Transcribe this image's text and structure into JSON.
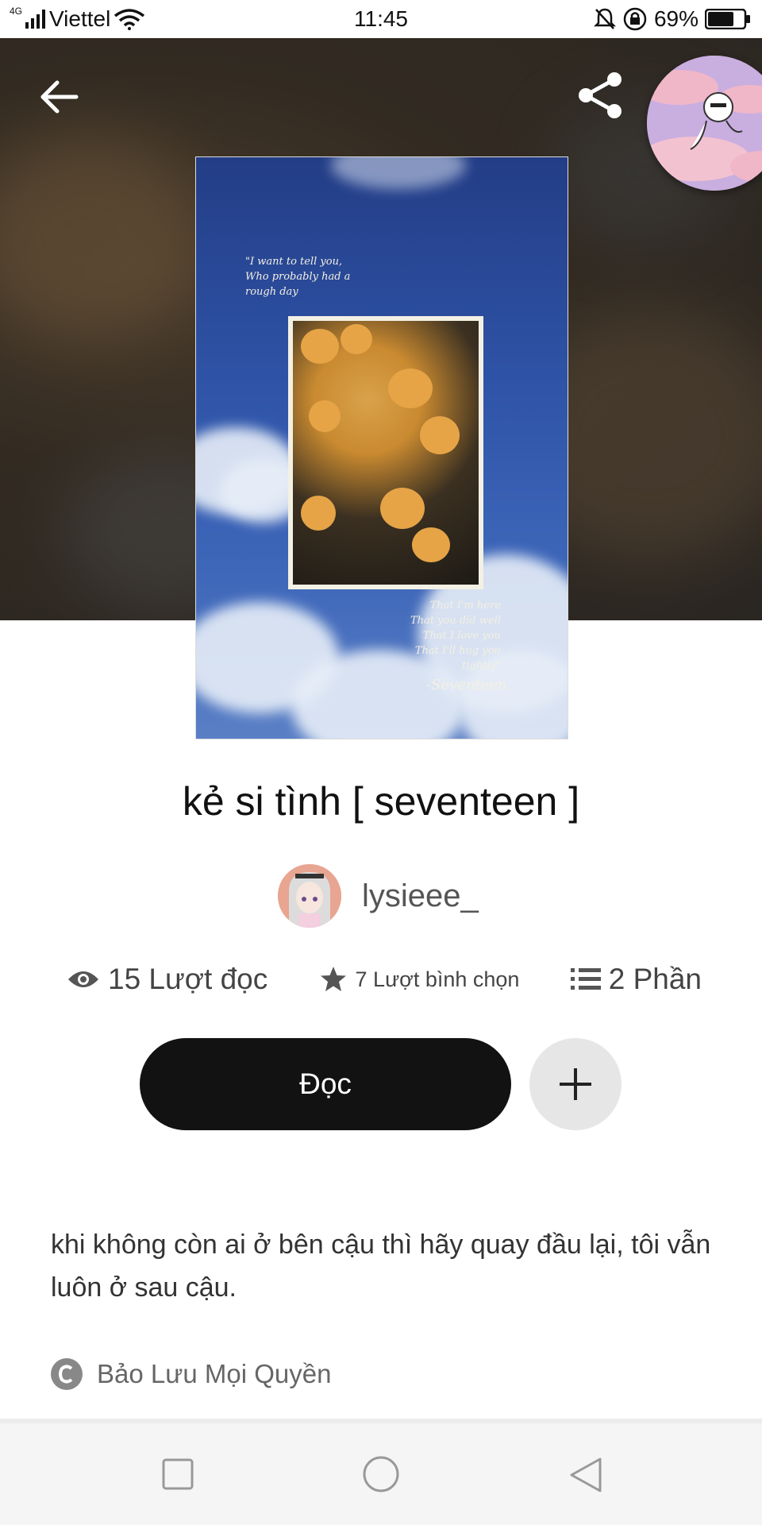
{
  "status_bar": {
    "network": "4G",
    "carrier": "Viettel",
    "time": "11:45",
    "battery": "69%"
  },
  "header": {
    "back_icon": "arrow-left-icon",
    "share_icon": "share-icon"
  },
  "cover": {
    "quote_top": "\"I want to tell you,\nWho probably had a\nrough day",
    "quote_bottom": "That I'm here\nThat you did well\nThat I love you\nThat I'll hug you\ntightly\"",
    "signature": "-Seventeen"
  },
  "story": {
    "title": "kẻ si tình [ seventeen ]",
    "author": "lysieee_",
    "reads": "15 Lượt đọc",
    "votes": "7 Lượt bình chọn",
    "parts": "2 Phần",
    "read_button": "Đọc",
    "description": "khi không còn ai ở bên cậu thì hãy quay đầu lại, tôi vẫn luôn ở sau cậu.",
    "copyright": "Bảo Lưu Mọi Quyền"
  },
  "colors": {
    "read_button_bg": "#121212",
    "add_button_bg": "#e6e6e6",
    "nav_bar_bg": "#f5f5f5"
  }
}
